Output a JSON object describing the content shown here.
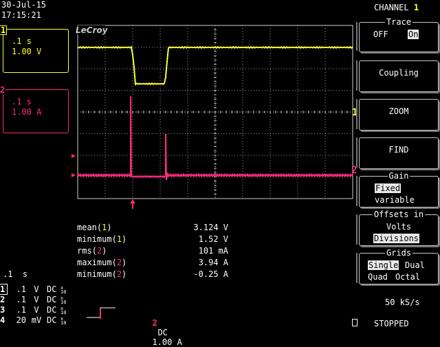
{
  "header": {
    "date": "30-Jul-15",
    "time": "17:15:21"
  },
  "logo": "LeCroy",
  "channel1": {
    "number": "1",
    "timebase": ".1 s",
    "scale": "1.00 V"
  },
  "channel2": {
    "number": "2",
    "timebase": ".1 s",
    "scale": "1.00 A"
  },
  "menu": {
    "channel_title": "CHANNEL",
    "channel_number": "1",
    "trace": {
      "title": "Trace",
      "off": "OFF",
      "on": "On",
      "selected": "On"
    },
    "coupling": "Coupling",
    "zoom": "ZOOM",
    "find": "FIND",
    "gain": {
      "title": "Gain",
      "fixed": "Fixed",
      "variable": "variable",
      "selected": "Fixed"
    },
    "offsets": {
      "title": "Offsets in",
      "volts": "Volts",
      "divisions": "Divisions",
      "selected": "Divisions"
    },
    "grids": {
      "title": "Grids",
      "single": "Single",
      "dual": "Dual",
      "quad": "Quad",
      "octal": "Octal",
      "selected": "Single"
    }
  },
  "markers": {
    "ch1_right": "1",
    "ch2_right": "2"
  },
  "measurements": [
    {
      "label": "mean",
      "channel": "1",
      "value": "3.124 V"
    },
    {
      "label": "minimum",
      "channel": "1",
      "value": "1.52 V"
    },
    {
      "label": "rms",
      "channel": "2",
      "value": "101 mA"
    },
    {
      "label": "maximum",
      "channel": "2",
      "value": "3.94 A"
    },
    {
      "label": "minimum",
      "channel": "2",
      "value": "-0.25 A"
    }
  ],
  "timebase_bottom": ".1  s",
  "bottom_channels": [
    {
      "n": "1",
      "volts": ".1",
      "unit": "V",
      "coupling": "DC"
    },
    {
      "n": "2",
      "volts": ".1",
      "unit": "V",
      "coupling": "DC"
    },
    {
      "n": "3",
      "volts": ".1",
      "unit": "V",
      "coupling": "DC"
    },
    {
      "n": "4",
      "volts": "20",
      "unit": "mV",
      "coupling": "DC"
    }
  ],
  "trigger": {
    "channel": "2",
    "coupling": "DC",
    "level": "1.00 A"
  },
  "sample_rate": "50 kS/s",
  "status": "STOPPED",
  "colors": {
    "ch1": "#ffff33",
    "ch2": "#ff2a7f",
    "grid": "#a0a0a0",
    "background": "#000000"
  }
}
